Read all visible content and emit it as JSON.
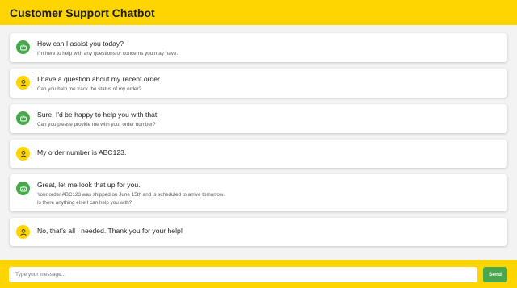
{
  "app": {
    "title": "Customer Support Chatbot"
  },
  "messages": [
    {
      "sender": "bot",
      "icon": "bot-icon",
      "text": "How can I assist you today?",
      "sub": [
        "I'm here to help with any questions or concerns you may have."
      ]
    },
    {
      "sender": "user",
      "icon": "user-icon",
      "text": "I have a question about my recent order.",
      "sub": [
        "Can you help me track the status of my order?"
      ]
    },
    {
      "sender": "bot",
      "icon": "bot-icon",
      "text": "Sure, I'd be happy to help you with that.",
      "sub": [
        "Can you please provide me with your order number?"
      ]
    },
    {
      "sender": "user",
      "icon": "user-icon",
      "text": "My order number is ABC123.",
      "sub": []
    },
    {
      "sender": "bot",
      "icon": "bot-icon",
      "text": "Great, let me look that up for you.",
      "sub": [
        "Your order ABC123 was shipped on June 15th and is scheduled to arrive tomorrow.",
        "Is there anything else I can help you with?"
      ]
    },
    {
      "sender": "user",
      "icon": "user-icon",
      "text": "No, that's all I needed. Thank you for your help!",
      "sub": []
    }
  ],
  "composer": {
    "placeholder": "Type your message...",
    "value": "",
    "send_label": "Send"
  },
  "colors": {
    "accent": "#ffd500",
    "bot": "#47a84b",
    "send": "#49a84d"
  }
}
